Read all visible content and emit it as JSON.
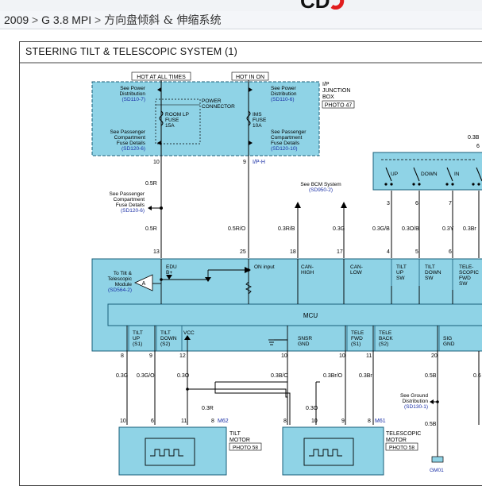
{
  "breadcrumb": {
    "year": "2009",
    "model": "G 3.8 MPI",
    "current": "方向盘倾斜 & 伸缩系统",
    "separator": ">"
  },
  "logo": {
    "text": "CD",
    "accent": "#e11d1d"
  },
  "diagram_title": "STEERING TILT & TELESCOPIC SYSTEM (1)",
  "colors": {
    "box_fill": "#8fd3e6",
    "box_stroke": "#1a5f7a",
    "wire": "#000000",
    "ref": "#1a2fa6"
  },
  "ij_box": {
    "hot_at_all_times": "HOT AT ALL TIMES",
    "hot_in_on": "HOT IN ON",
    "title_l1": "I/P",
    "title_l2": "JUNCTION",
    "title_l3": "BOX",
    "photo": "PHOTO 47",
    "see_power_l1": "See Power",
    "see_power_l2": "Distribution",
    "ref1": "(SD110-7)",
    "ref2": "(SD110-6)",
    "power_connector_l1": "POWER",
    "power_connector_l2": "CONNECTOR",
    "fuse1_l1": "ROOM LP",
    "fuse1_l2": "FUSE",
    "fuse1_l3": "15A",
    "fuse2_l1": "IMS",
    "fuse2_l2": "FUSE",
    "fuse2_l3": "10A",
    "see_pass_l1": "See Passenger",
    "see_pass_l2": "Compartment",
    "see_pass_l3": "Fuse Details",
    "ref3": "(SD120-6)",
    "ref4": "(SD120-10)",
    "pin_left": "10",
    "pin_right": "9",
    "conn_ip": "I/P-H"
  },
  "left_ref": {
    "l1": "See Passenger",
    "l2": "Compartment",
    "l3": "Fuse Details",
    "ref": "(SD120-6)"
  },
  "bcm_ref": {
    "l1": "See BCM System",
    "ref": "(SD950-2)"
  },
  "switch_box": {
    "up": "UP",
    "down": "DOWN",
    "in": "IN",
    "wire_top": "0.3B",
    "pin_top": "6"
  },
  "wires_top": [
    {
      "color": "0.5R",
      "pin": "13"
    },
    {
      "color": "0.5R/O",
      "pin": "25"
    },
    {
      "color": "0.3R/B",
      "pin": "18"
    },
    {
      "color": "0.3G",
      "pin": "17"
    },
    {
      "color": "0.3G/B",
      "pin": "4",
      "pin_sw": "3"
    },
    {
      "color": "0.3O/B",
      "pin": "5",
      "pin_sw": "6"
    },
    {
      "color": "0.3Y",
      "pin": "6",
      "pin_sw": "7"
    },
    {
      "color": "0.3Br"
    }
  ],
  "wire_05R_mid": "0.5R",
  "module": {
    "edu_l1": "EDU",
    "edu_l2": "B+",
    "on_input": "ON input",
    "can_high_l1": "CAN-",
    "can_high_l2": "HIGH",
    "can_low_l1": "CAN-",
    "can_low_l2": "LOW",
    "tilt_up_l1": "TILT",
    "tilt_up_l2": "UP",
    "tilt_up_l3": "SW",
    "tilt_down_l1": "TILT",
    "tilt_down_l2": "DOWN",
    "tilt_down_l3": "SW",
    "tele_fwd_l1": "TELE-",
    "tele_fwd_l2": "SCOPIC",
    "tele_fwd_l3": "FWD",
    "tele_fwd_l4": "SW",
    "mcu": "MCU",
    "left_ref_l1": "To Tilt &",
    "left_ref_l2": "Telescopic",
    "left_ref_l3": "Module",
    "left_ref_ref": "(SD564-2)",
    "bottom": [
      {
        "l1": "TILT",
        "l2": "UP",
        "l3": "(S1)"
      },
      {
        "l1": "TILT",
        "l2": "DOWN",
        "l3": "(S2)"
      },
      {
        "l1": "VCC"
      },
      {
        "l1": "SNSR",
        "l2": "GND"
      },
      {
        "l1": "TELE",
        "l2": "FWD",
        "l3": "(S1)"
      },
      {
        "l1": "TELE",
        "l2": "BACK",
        "l3": "(S2)"
      },
      {
        "l1": "SIG",
        "l2": "GND"
      }
    ]
  },
  "wires_bottom": [
    {
      "pin": "8",
      "color": "0.3G"
    },
    {
      "pin": "9",
      "color": "0.3G/O"
    },
    {
      "pin": "12",
      "color": "0.3O"
    },
    {
      "pin": "10",
      "color": "0.3B/O"
    },
    {
      "pin": "10",
      "color": "0.3Br/O"
    },
    {
      "pin": "11",
      "color": "0.3Br"
    },
    {
      "pin": "20",
      "color": "0.5B"
    },
    {
      "color": "0.6"
    }
  ],
  "mid_wires": {
    "w1": "0.3R",
    "w2": "0.3O"
  },
  "ground_ref": {
    "l1": "See Ground",
    "l2": "Distribution",
    "ref": "(SD130-1)",
    "wire": "0.5B",
    "ground": "GM01"
  },
  "tilt_motor": {
    "pins": [
      "10",
      "6",
      "11",
      "8"
    ],
    "conn": "M62",
    "title_l1": "TILT",
    "title_l2": "MOTOR",
    "photo": "PHOTO 58"
  },
  "tele_motor": {
    "pins": [
      "8",
      "10",
      "9",
      "8"
    ],
    "conn": "M61",
    "title_l1": "TELESCOPIC",
    "title_l2": "MOTOR",
    "photo": "PHOTO 58"
  }
}
